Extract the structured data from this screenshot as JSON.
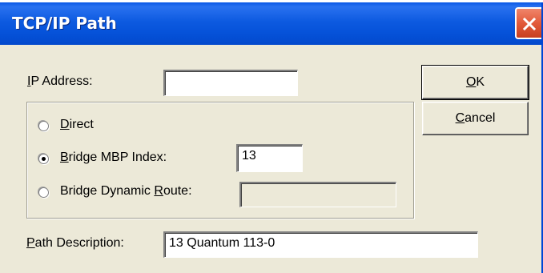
{
  "window": {
    "title": "TCP/IP Path",
    "close_icon": "close-x-icon"
  },
  "ip_address": {
    "label_prefix": "I",
    "label_rest": "P Address:",
    "value": ""
  },
  "route_options": {
    "direct": {
      "label_prefix": "D",
      "label_rest": "irect",
      "selected": false
    },
    "bridge_mbp_index": {
      "label_prefix": "B",
      "label_rest": "ridge MBP Index:",
      "value": "13",
      "selected": true
    },
    "bridge_dynamic_route": {
      "label_before": "Bridge Dynamic ",
      "label_accel": "R",
      "label_after": "oute:",
      "value": "",
      "selected": false,
      "field_enabled": false
    }
  },
  "path_description": {
    "label_prefix": "P",
    "label_rest": "ath Description:",
    "value": "13 Quantum 113-0"
  },
  "buttons": {
    "ok": {
      "accel": "O",
      "rest": "K"
    },
    "cancel": {
      "accel": "C",
      "rest": "ancel"
    }
  }
}
